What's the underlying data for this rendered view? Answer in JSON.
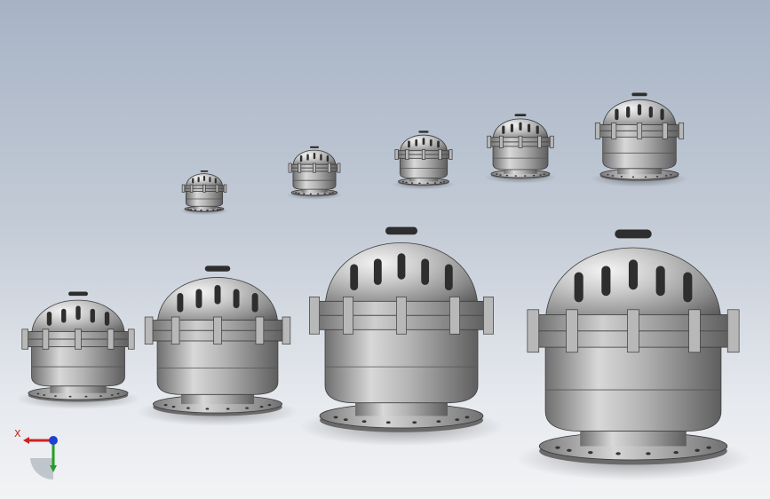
{
  "viewport": {
    "background_top": "#a7b3c5",
    "background_bottom": "#f2f3f5",
    "model_color": "#9a9a9a"
  },
  "valves": {
    "small_row_count": 5,
    "large_row_count": 4
  },
  "triad": {
    "x_label": "X",
    "x_color": "#d02020",
    "y_color": "#20a020",
    "z_color": "#2040d0"
  }
}
